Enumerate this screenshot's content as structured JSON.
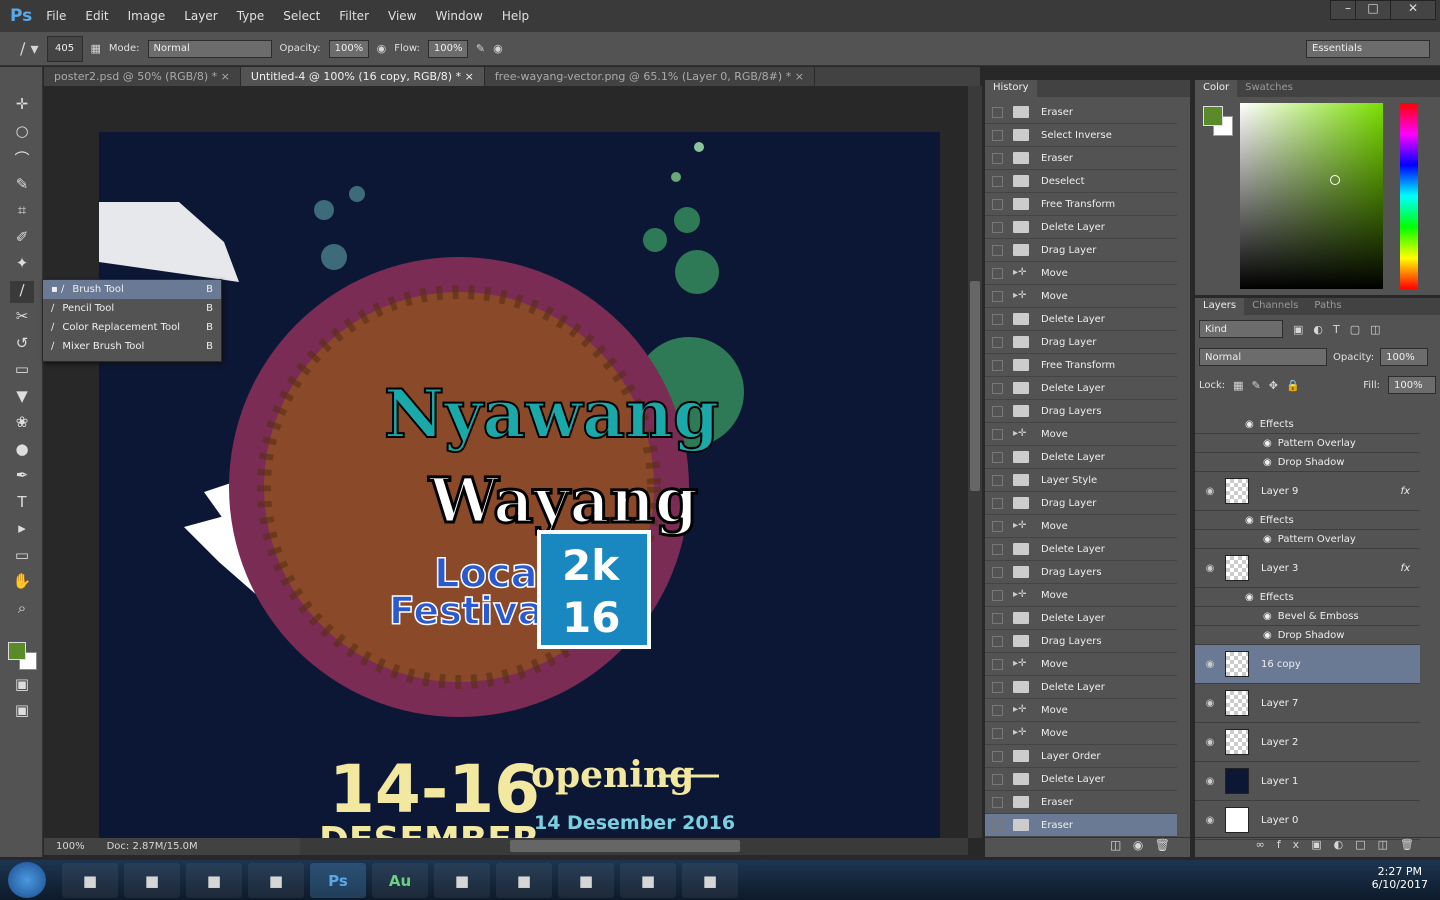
{
  "app": {
    "logo": "Ps",
    "menus": [
      "File",
      "Edit",
      "Image",
      "Layer",
      "Type",
      "Select",
      "Filter",
      "View",
      "Window",
      "Help"
    ]
  },
  "options": {
    "brush_size": "405",
    "mode_label": "Mode:",
    "mode": "Normal",
    "opacity_label": "Opacity:",
    "opacity": "100%",
    "flow_label": "Flow:",
    "flow": "100%",
    "workspace": "Essentials"
  },
  "tabs": [
    {
      "label": "poster2.psd @ 50% (RGB/8) *"
    },
    {
      "label": "Untitled-4 @ 100% (16 copy, RGB/8) *"
    },
    {
      "label": "free-wayang-vector.png @ 65.1% (Layer 0, RGB/8#) *"
    }
  ],
  "flyout": [
    {
      "label": "Brush Tool",
      "key": "B"
    },
    {
      "label": "Pencil Tool",
      "key": "B"
    },
    {
      "label": "Color Replacement Tool",
      "key": "B"
    },
    {
      "label": "Mixer Brush Tool",
      "key": "B"
    }
  ],
  "status": {
    "zoom": "100%",
    "doc": "Doc: 2.87M/15.0M"
  },
  "artwork": {
    "title1": "Nyawang",
    "title2": "Wayang",
    "sub1": "Local",
    "sub2": "Festival",
    "year1": "2k",
    "year2": "16",
    "dates": "14-16",
    "month": "DESEMBER",
    "opening": "opening",
    "opening_date": "14 Desember 2016"
  },
  "history": {
    "title": "History",
    "items": [
      "Eraser",
      "Select Inverse",
      "Eraser",
      "Deselect",
      "Free Transform",
      "Delete Layer",
      "Drag Layer",
      "Move",
      "Move",
      "Delete Layer",
      "Drag Layer",
      "Free Transform",
      "Delete Layer",
      "Drag Layers",
      "Move",
      "Delete Layer",
      "Layer Style",
      "Drag Layer",
      "Move",
      "Delete Layer",
      "Drag Layers",
      "Move",
      "Delete Layer",
      "Drag Layers",
      "Move",
      "Delete Layer",
      "Move",
      "Move",
      "Layer Order",
      "Delete Layer",
      "Eraser",
      "Eraser"
    ],
    "selected": 31
  },
  "color": {
    "tabs": [
      "Color",
      "Swatches"
    ],
    "foreground": "#5a8a2a",
    "background": "#ffffff",
    "hue": "#7be000"
  },
  "layers": {
    "tabs": [
      "Layers",
      "Channels",
      "Paths"
    ],
    "filter": "Kind",
    "blend": "Normal",
    "opacity_label": "Opacity:",
    "opacity": "100%",
    "lock_label": "Lock:",
    "fill_label": "Fill:",
    "fill": "100%",
    "rows": [
      {
        "type": "fx",
        "label": "Effects"
      },
      {
        "type": "effect",
        "label": "Pattern Overlay"
      },
      {
        "type": "effect",
        "label": "Drop Shadow"
      },
      {
        "type": "layer",
        "label": "Layer 9",
        "fx": "fx"
      },
      {
        "type": "fx",
        "label": "Effects"
      },
      {
        "type": "effect",
        "label": "Pattern Overlay"
      },
      {
        "type": "layer",
        "label": "Layer 3",
        "fx": "fx"
      },
      {
        "type": "fx",
        "label": "Effects"
      },
      {
        "type": "effect",
        "label": "Bevel & Emboss"
      },
      {
        "type": "effect",
        "label": "Drop Shadow"
      },
      {
        "type": "layer",
        "label": "16 copy",
        "selected": true
      },
      {
        "type": "layer",
        "label": "Layer 7"
      },
      {
        "type": "layer",
        "label": "Layer 2"
      },
      {
        "type": "layer",
        "label": "Layer 1",
        "fill": "#0c1736"
      },
      {
        "type": "layer",
        "label": "Layer 0",
        "fill": "#ffffff"
      }
    ]
  },
  "taskbar": {
    "apps": [
      "Ps",
      "Au"
    ],
    "time": "2:27 PM",
    "date": "6/10/2017"
  }
}
